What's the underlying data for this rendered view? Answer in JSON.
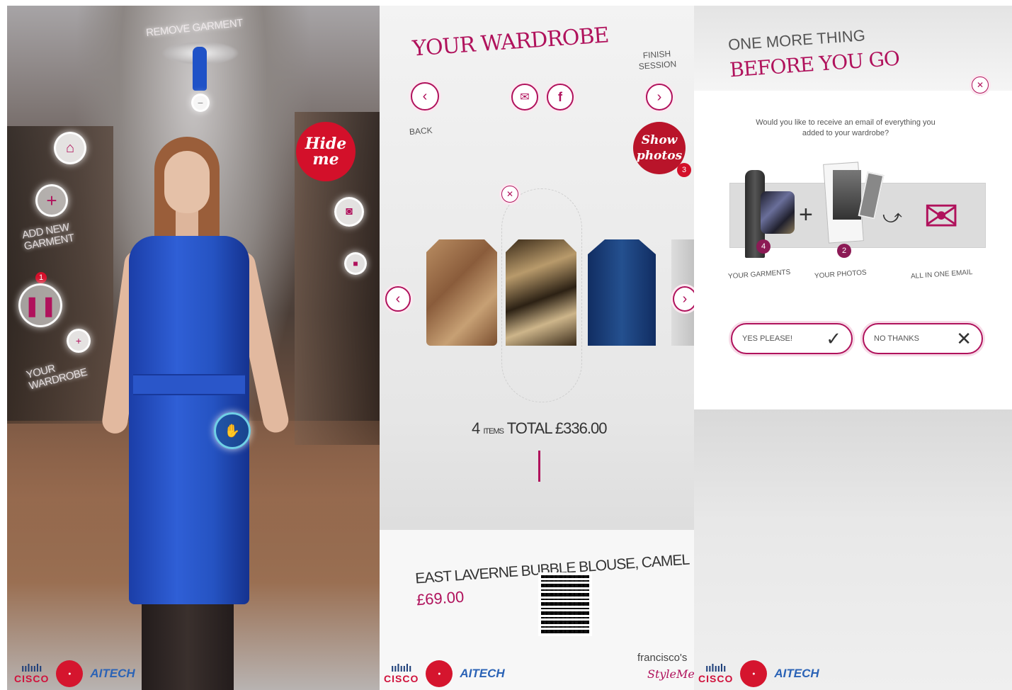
{
  "mirror": {
    "remove_garment_label": "REMOVE GARMENT",
    "add_new_garment_label": "ADD NEW GARMENT",
    "your_wardrobe_label": "YOUR WARDROBE",
    "hide_me_label": "Hide me",
    "pause_badge": "1",
    "icons": [
      "home-icon",
      "plus-icon",
      "pause-icon",
      "camera-icon",
      "hand-icon",
      "hanger-icon",
      "minus-icon"
    ]
  },
  "wardrobe": {
    "title": "YOUR WARDROBE",
    "back_label": "BACK",
    "finish_session_label": "FINISH SESSION",
    "show_photos_label": "Show photos",
    "photo_count": "3",
    "items_count": "4",
    "items_label": "ITEMS",
    "total_label": "TOTAL",
    "total_value": "£336.00",
    "product_name": "EAST LAVERNE BUBBLE BLOUSE, CAMEL",
    "product_price": "£69.00",
    "brand_prefix": "francisco's",
    "brand_name": "StyleMe",
    "brand_tm": "™"
  },
  "before_you_go": {
    "kicker": "ONE MORE THING",
    "title": "BEFORE YOU GO",
    "question": "Would you like to receive an email of everything you added to your wardrobe?",
    "garments_count": "4",
    "photos_count": "2",
    "garments_label": "YOUR GARMENTS",
    "photos_label": "YOUR PHOTOS",
    "email_label": "ALL IN ONE EMAIL",
    "yes_label": "YES PLEASE!",
    "no_label": "NO THANKS"
  },
  "logos": {
    "cisco": "CISCO",
    "aitech": "AITECH"
  },
  "colors": {
    "accent": "#b0125c",
    "red_button": "#d3102a",
    "dress_blue": "#2553c2"
  }
}
